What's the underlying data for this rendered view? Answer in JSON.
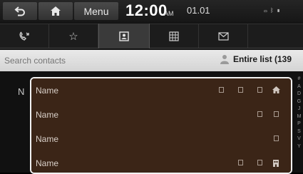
{
  "topbar": {
    "back_icon": "back-arrow-icon",
    "home_icon": "home-icon",
    "menu_label": "Menu",
    "time": "12:00",
    "ampm": "AM",
    "date": "01.01",
    "status_icons": "battery-bluetooth-signal"
  },
  "tabs": [
    {
      "icon": "call-history-icon",
      "active": false
    },
    {
      "icon": "favorites-star-icon",
      "active": false
    },
    {
      "icon": "contacts-icon",
      "active": true
    },
    {
      "icon": "dial-pad-icon",
      "active": false
    },
    {
      "icon": "messages-icon",
      "active": false
    }
  ],
  "search": {
    "placeholder": "Search contacts",
    "filter_label": "Entire list (139"
  },
  "list": {
    "index_letter": "N",
    "rows": [
      {
        "name": "Name"
      },
      {
        "name": "Name"
      },
      {
        "name": "Name"
      },
      {
        "name": "Name"
      }
    ]
  },
  "alphabet": [
    "#",
    "A",
    "D",
    "G",
    "J",
    "M",
    "P",
    "S",
    "V",
    "Y"
  ],
  "colors": {
    "list_background": "#3b2517",
    "frame_border": "#f2f2f2",
    "search_background": "#e0e0e0"
  }
}
